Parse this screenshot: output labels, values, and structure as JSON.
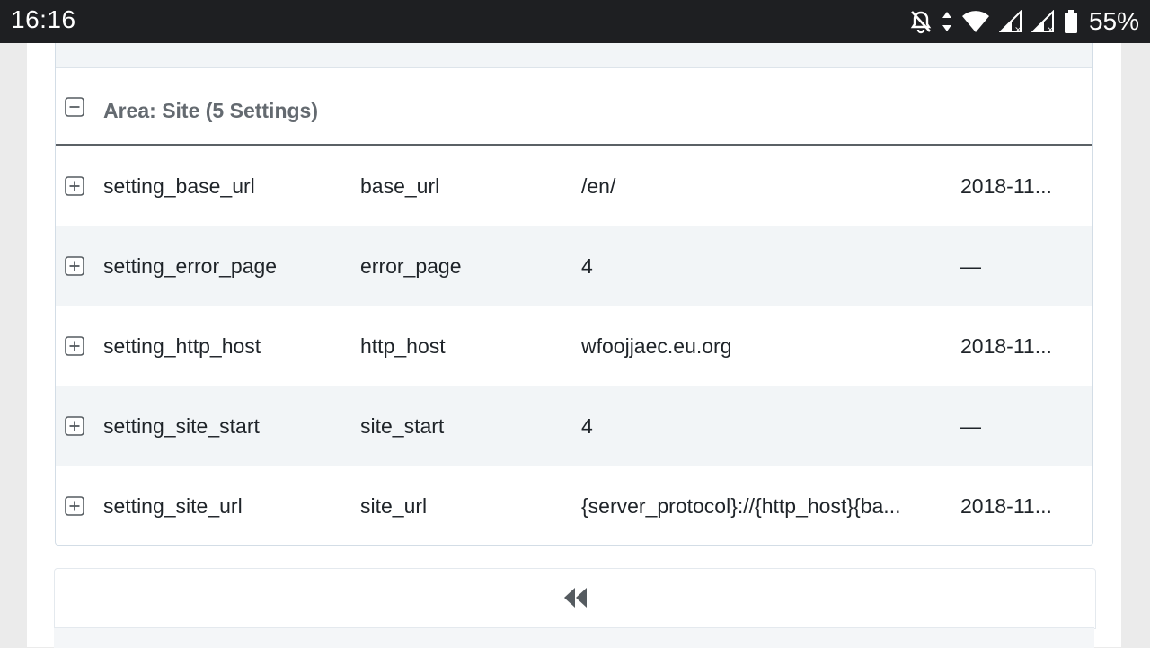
{
  "status_bar": {
    "time": "16:16",
    "battery_percent": "55%",
    "icons": [
      "notifications-off-icon",
      "data-transfer-icon",
      "wifi-icon",
      "signal-icon",
      "signal-icon",
      "battery-icon"
    ]
  },
  "group": {
    "title": "Area: Site (5 Settings)",
    "toggle_icon": "collapse-minus-icon"
  },
  "rows": [
    {
      "name": "setting_base_url",
      "key": "base_url",
      "value": "/en/",
      "date": "2018-11..."
    },
    {
      "name": "setting_error_page",
      "key": "error_page",
      "value": "4",
      "date": "—"
    },
    {
      "name": "setting_http_host",
      "key": "http_host",
      "value": "wfoojjaec.eu.org",
      "date": "2018-11..."
    },
    {
      "name": "setting_site_start",
      "key": "site_start",
      "value": "4",
      "date": "—"
    },
    {
      "name": "setting_site_url",
      "key": "site_url",
      "value": "{server_protocol}://{http_host}{ba...",
      "date": "2018-11..."
    }
  ],
  "pager": {
    "first_icon": "double-chevron-left-icon"
  },
  "colors": {
    "status_bar_bg": "#1e1f22",
    "alt_row_bg": "#f2f5f7",
    "header_rule": "#5b6166"
  }
}
